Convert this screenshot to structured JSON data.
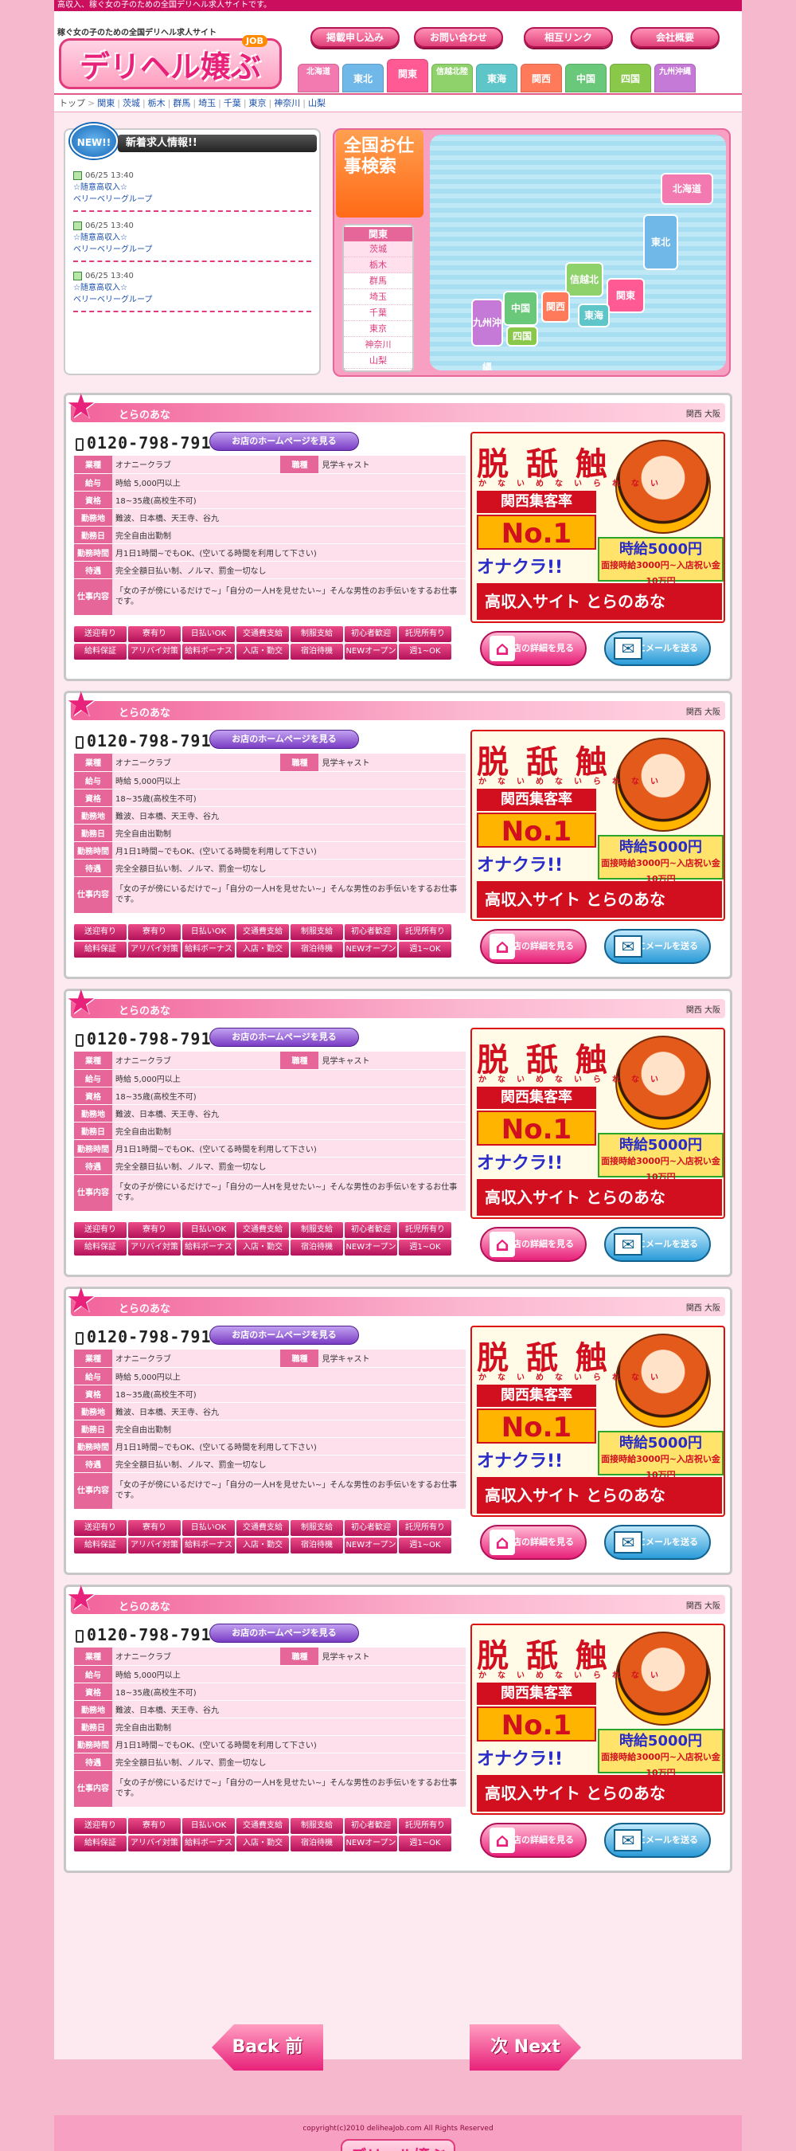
{
  "site": {
    "top_text": "高収入、稼ぐ女の子のための全国デリヘル求人サイトです。",
    "tagline": "稼ぐ女の子のための全国デリヘル求人サイト",
    "logo": "デリヘル嬢ぶ",
    "logo_badge": "JOB"
  },
  "header_buttons": [
    "掲載申し込み",
    "お問い合わせ",
    "相互リンク",
    "会社概要"
  ],
  "region_tabs": [
    {
      "label": "北海道",
      "color": "#f27ab0"
    },
    {
      "label": "東北",
      "color": "#6fb8e8"
    },
    {
      "label": "関東",
      "color": "#ff5a94"
    },
    {
      "label": "信越北陸",
      "color": "#8fd16a"
    },
    {
      "label": "東海",
      "color": "#5ec6c8"
    },
    {
      "label": "関西",
      "color": "#ff7a5a"
    },
    {
      "label": "中国",
      "color": "#6ac87a"
    },
    {
      "label": "四国",
      "color": "#8ac84a"
    },
    {
      "label": "九州沖縄",
      "color": "#c67ad8"
    }
  ],
  "breadcrumb": [
    "トップ",
    "関東",
    "茨城",
    "栃木",
    "群馬",
    "埼玉",
    "千葉",
    "東京",
    "神奈川",
    "山梨"
  ],
  "news": {
    "badge": "NEW!!",
    "title": "新着求人情報!!",
    "items": [
      {
        "date": "06/25 13:40",
        "title": "☆随意高収入☆",
        "group": "ベリーベリーグループ"
      },
      {
        "date": "06/25 13:40",
        "title": "☆随意高収入☆",
        "group": "ベリーベリーグループ"
      },
      {
        "date": "06/25 13:40",
        "title": "☆随意高収入☆",
        "group": "ベリーベリーグループ"
      }
    ]
  },
  "area_search": {
    "title": "全国お仕事検索",
    "region": "関東",
    "prefectures": [
      "茨城",
      "栃木",
      "群馬",
      "埼玉",
      "千葉",
      "東京",
      "神奈川",
      "山梨"
    ]
  },
  "listing": {
    "name": "とらのあな",
    "area": "関西 大阪",
    "phone": "0120-798-791",
    "hp_label": "お店のホームページを見る",
    "fields": {
      "industry_label": "業種",
      "industry": "オナニークラブ",
      "job_label": "職種",
      "job": "見学キャスト",
      "pay_label": "給与",
      "pay": "時給 5,000円以上",
      "age_label": "資格",
      "age": "18~35歳(高校生不可)",
      "location_label": "勤務地",
      "location": "難波、日本橋、天王寺、谷九",
      "days_label": "勤務日",
      "days": "完全自由出勤制",
      "hours_label": "勤務時間",
      "hours": "月1日1時間~でもOK、(空いてる時間を利用して下さい)",
      "benefits_label": "待遇",
      "benefits": "完全全額日払い制、ノルマ、罰金一切なし",
      "content_label": "仕事内容",
      "content": "「女の子が傍にいるだけで~」「自分の一人Hを見せたい~」そんな男性のお手伝いをするお仕事です。"
    },
    "tags": [
      "送迎有り",
      "寮有り",
      "日払いOK",
      "交通費支給",
      "制服支給",
      "初心者歓迎",
      "託児所有り",
      "給料保証",
      "アリバイ対策",
      "給料ボーナス",
      "入店・勤交",
      "宿泊待機",
      "NEWオープン",
      "週1~OK"
    ],
    "banner": {
      "line1": "脱 舐 触",
      "line1_sub": "かないめないられない",
      "collector": "関西集客率",
      "no1": "No.1",
      "okura": "オナクラ!!",
      "pay": "時給5000円",
      "pay_sub": "面接時給3000円~入店祝い金10万円",
      "bottom": "高収入サイト とらのあな"
    },
    "detail_label": "お店の詳細を見る",
    "mail_label": "お店にメールを送る"
  },
  "pager": {
    "back": "Back 前",
    "next": "次 Next"
  },
  "footer": {
    "copyright": "copyright(c)2010 deliheaJob.com All Rights Reserved",
    "logo": "デリヘル嬢ぶ"
  }
}
